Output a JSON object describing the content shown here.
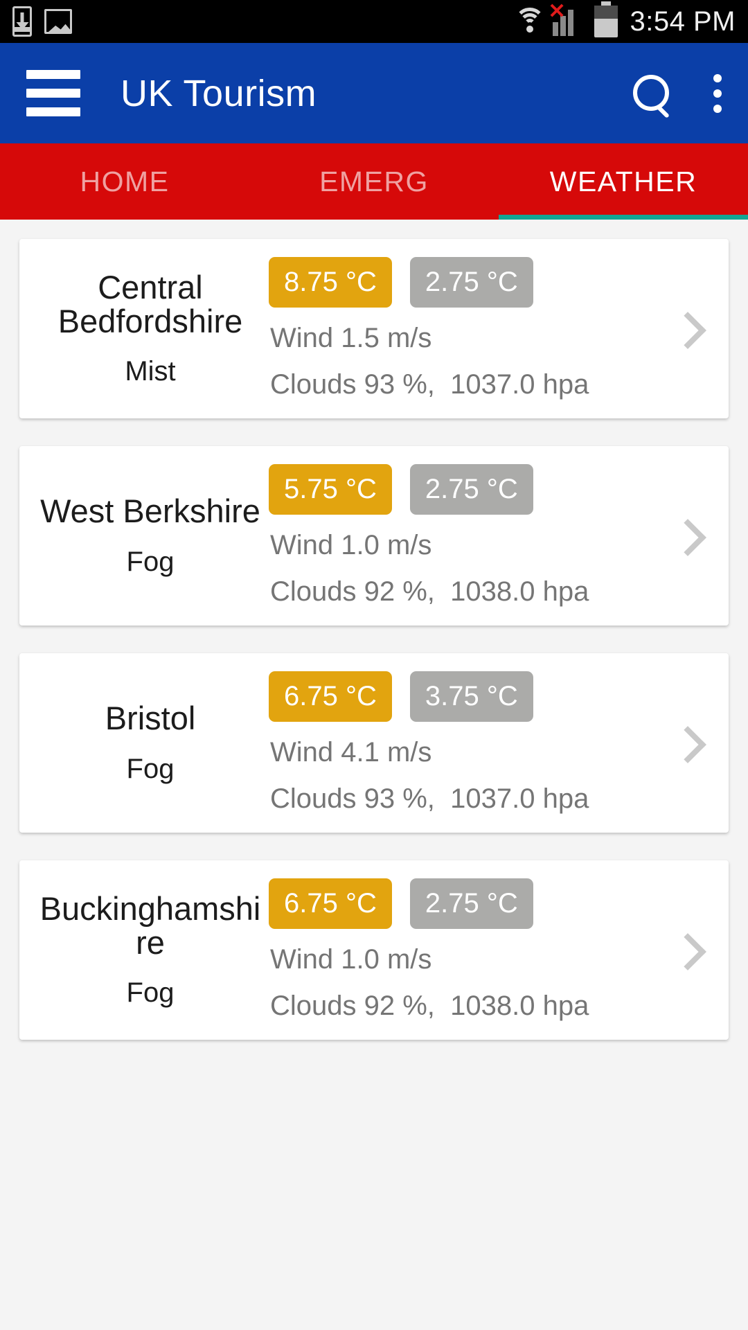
{
  "status_bar": {
    "time": "3:54 PM",
    "icons": [
      "download-icon",
      "image-icon",
      "wifi-icon",
      "signal-no-service-icon",
      "battery-icon"
    ]
  },
  "app_bar": {
    "title": "UK Tourism",
    "menu_icon": "hamburger-menu-icon",
    "search_icon": "search-icon",
    "overflow_icon": "more-vertical-icon"
  },
  "tabs": {
    "items": [
      {
        "label": "HOME",
        "active": false
      },
      {
        "label": "EMERG",
        "active": false
      },
      {
        "label": "WEATHER",
        "active": true
      }
    ],
    "indicator_color": "#12a594",
    "bar_color": "#d60909"
  },
  "colors": {
    "app_bar": "#0b3fa8",
    "tab_bar": "#d60909",
    "max_temp_chip": "#e2a40f",
    "min_temp_chip": "#ababa9",
    "page_background": "#f4f4f4",
    "card_background": "#ffffff"
  },
  "weather_list": [
    {
      "city": "Central Bedfordshire",
      "condition": "Mist",
      "temp_max": "8.75 °C",
      "temp_min": "2.75 °C",
      "wind": "Wind 1.5 m/s",
      "clouds_pressure": "Clouds 93 %,  1037.0 hpa",
      "chevron": "chevron-right-icon"
    },
    {
      "city": "West Berkshire",
      "condition": "Fog",
      "temp_max": "5.75 °C",
      "temp_min": "2.75 °C",
      "wind": "Wind 1.0 m/s",
      "clouds_pressure": "Clouds 92 %,  1038.0 hpa",
      "chevron": "chevron-right-icon"
    },
    {
      "city": "Bristol",
      "condition": "Fog",
      "temp_max": "6.75 °C",
      "temp_min": "3.75 °C",
      "wind": "Wind 4.1 m/s",
      "clouds_pressure": "Clouds 93 %,  1037.0 hpa",
      "chevron": "chevron-right-icon"
    },
    {
      "city": "Buckinghamshire",
      "condition": "Fog",
      "temp_max": "6.75 °C",
      "temp_min": "2.75 °C",
      "wind": "Wind 1.0 m/s",
      "clouds_pressure": "Clouds 92 %,  1038.0 hpa",
      "chevron": "chevron-right-icon"
    }
  ]
}
